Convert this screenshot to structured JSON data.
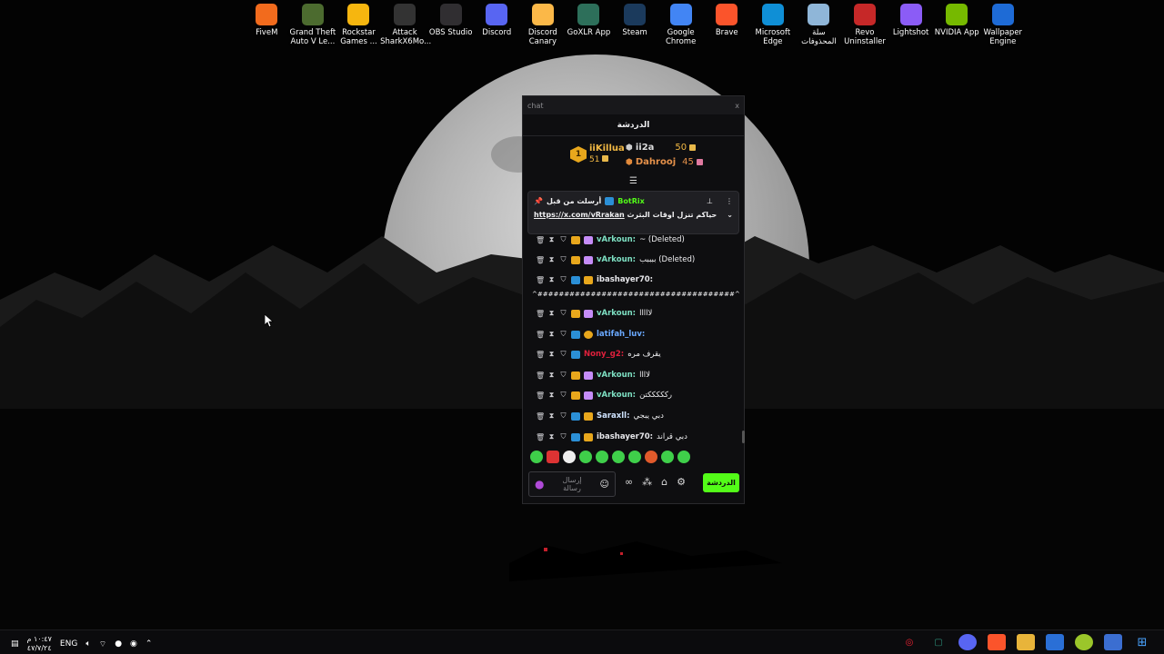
{
  "desktop_icons": [
    {
      "label": "FiveM",
      "icon": "fivem-icon",
      "color": "#f26b1d"
    },
    {
      "label": "Grand Theft Auto V Le...",
      "icon": "gta-v-icon",
      "color": "#4c6b2f"
    },
    {
      "label": "Rockstar Games ...",
      "icon": "rockstar-icon",
      "color": "#f6b60f"
    },
    {
      "label": "Attack SharkX6Mo...",
      "icon": "attack-shark-icon",
      "color": "#333333"
    },
    {
      "label": "OBS Studio",
      "icon": "obs-icon",
      "color": "#302e31"
    },
    {
      "label": "Discord",
      "icon": "discord-icon",
      "color": "#5865f2"
    },
    {
      "label": "Discord Canary",
      "icon": "discord-canary-icon",
      "color": "#fbb848"
    },
    {
      "label": "GoXLR App",
      "icon": "goxlr-icon",
      "color": "#2d6f5a"
    },
    {
      "label": "Steam",
      "icon": "steam-icon",
      "color": "#1b3a5c"
    },
    {
      "label": "Google Chrome",
      "icon": "chrome-icon",
      "color": "#4285f4"
    },
    {
      "label": "Brave",
      "icon": "brave-icon",
      "color": "#fb542b"
    },
    {
      "label": "Microsoft Edge",
      "icon": "edge-icon",
      "color": "#0f8fd6"
    },
    {
      "label": "سلة المحذوفات",
      "icon": "recycle-bin-icon",
      "color": "#8fb6d8"
    },
    {
      "label": "Revo Uninstaller",
      "icon": "revo-icon",
      "color": "#c62828"
    },
    {
      "label": "Lightshot",
      "icon": "lightshot-icon",
      "color": "#8b5cf6"
    },
    {
      "label": "NVIDIA App",
      "icon": "nvidia-icon",
      "color": "#76b900"
    },
    {
      "label": "Wallpaper Engine",
      "icon": "wallpaper-engine-icon",
      "color": "#1e6bd6"
    }
  ],
  "chat": {
    "window_title": "chat",
    "close": "x",
    "header": "الدردشة",
    "leaderboard": {
      "top": {
        "rank": "1",
        "name": "iiKillua",
        "points": "51"
      },
      "second": {
        "name": "ii2a",
        "points": "50"
      },
      "third": {
        "name": "Dahrooj",
        "points": "45"
      }
    },
    "pinned": {
      "sent_by": "أرسلت من قبل",
      "author": "BotRix",
      "text": "حياكم تنزل اوقات البثرث",
      "link": "https://x.com/vRrakan"
    },
    "messages": [
      {
        "name": "vArkoun:",
        "name_color": "#7ee0c3",
        "text": "~ (Deleted)",
        "badges": [
          "crown",
          "gift"
        ]
      },
      {
        "name": "vArkoun:",
        "name_color": "#7ee0c3",
        "text": "ببببب (Deleted)",
        "badges": [
          "crown",
          "gift"
        ]
      },
      {
        "name": "ibashayer70:",
        "name_color": "#e6e6ea",
        "text": "",
        "badges": [
          "blue",
          "crown"
        ]
      },
      {
        "name": "",
        "name_color": "#e6e6ea",
        "text": "^#####################################^",
        "badges": []
      },
      {
        "name": "vArkoun:",
        "name_color": "#7ee0c3",
        "text": "لااااا",
        "badges": [
          "crown",
          "gift"
        ]
      },
      {
        "name": "latifah_luv:",
        "name_color": "#6aa9ff",
        "text": "",
        "badges": [
          "blue",
          "gold"
        ]
      },
      {
        "name": "Nony_g2:",
        "name_color": "#e0203c",
        "text": "يقرف مره",
        "badges": [
          "blue"
        ]
      },
      {
        "name": "vArkoun:",
        "name_color": "#7ee0c3",
        "text": "لاااا",
        "badges": [
          "crown",
          "gift"
        ]
      },
      {
        "name": "vArkoun:",
        "name_color": "#7ee0c3",
        "text": "ركككككتن",
        "badges": [
          "crown",
          "gift"
        ]
      },
      {
        "name": "Saraxll:",
        "name_color": "#cfe3ff",
        "text": "دبي يبجي",
        "badges": [
          "blue",
          "crown"
        ]
      },
      {
        "name": "ibashayer70:",
        "name_color": "#e6e6ea",
        "text": "دبي قراند",
        "badges": [
          "blue",
          "crown"
        ]
      }
    ],
    "input_placeholder": "إرسال رسالة",
    "send_label": "الدردشة"
  },
  "taskbar": {
    "time": "١٠:٤٧ م",
    "date": "٤٧/٧/٢٤",
    "lang": "ENG"
  }
}
